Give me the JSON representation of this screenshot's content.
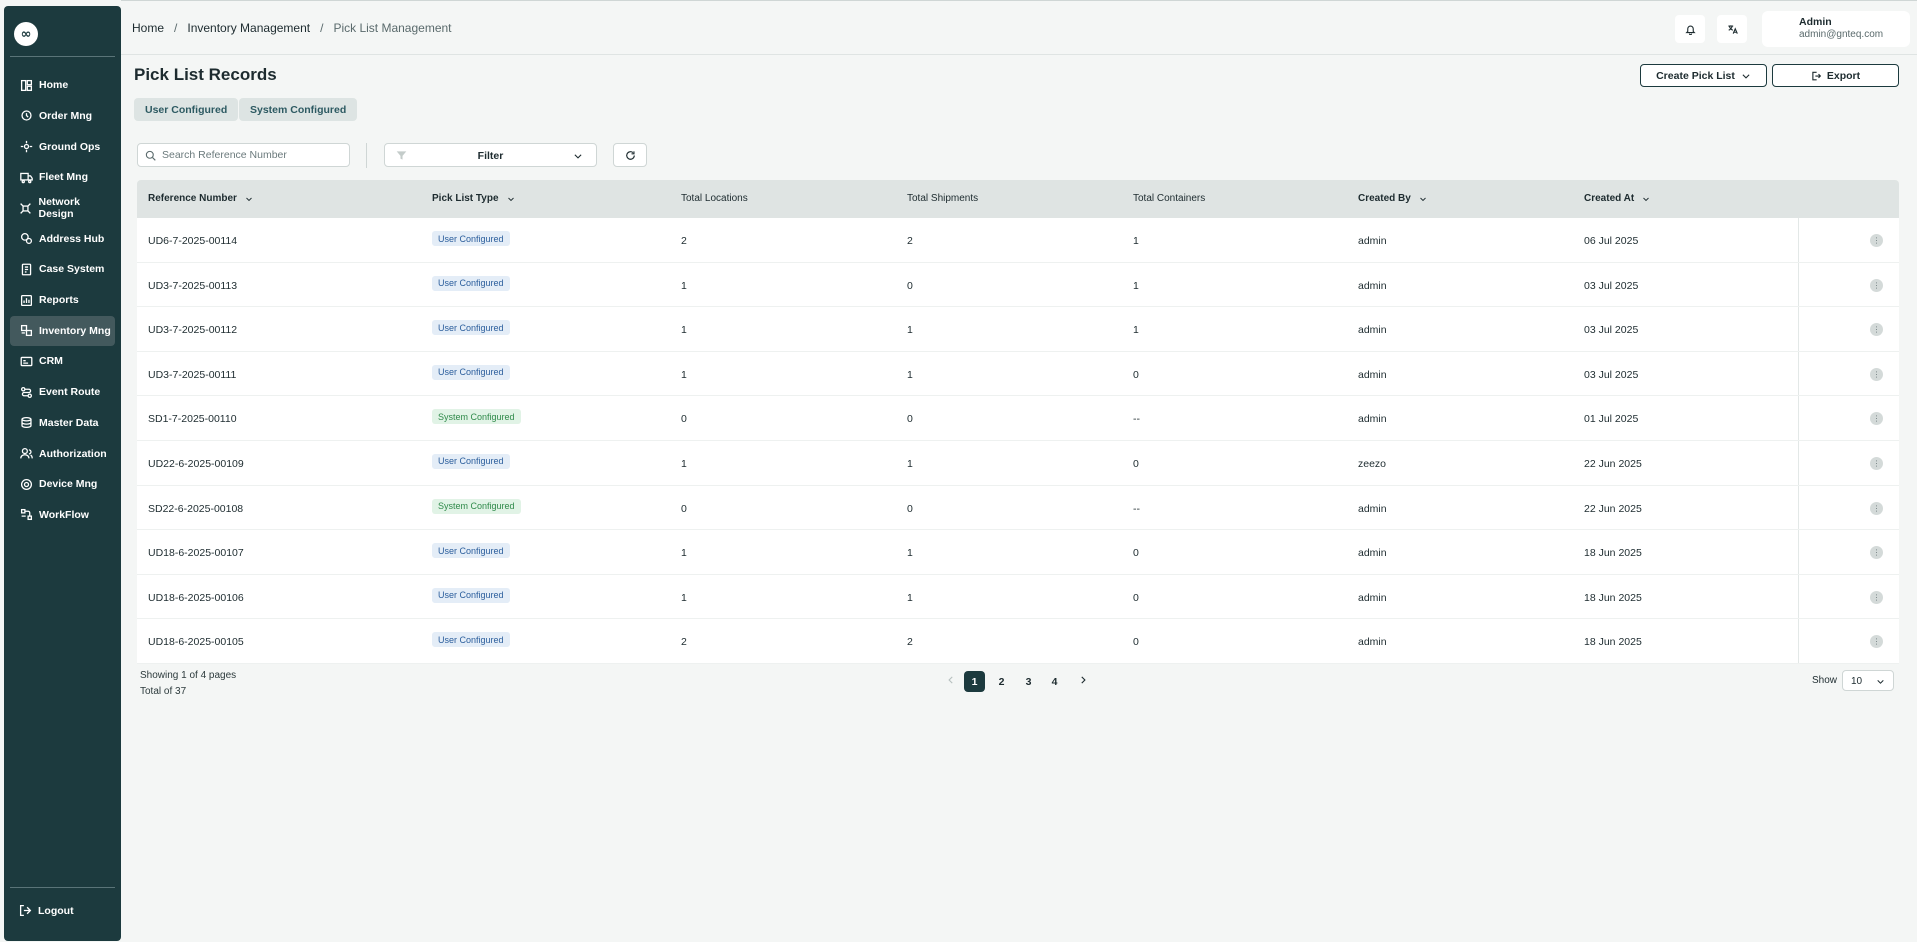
{
  "app": {
    "logo_glyph": "∞",
    "accent_color": "#1c3a3e"
  },
  "sidebar": {
    "items": [
      {
        "label": "Home",
        "icon": "home-icon"
      },
      {
        "label": "Order Mng",
        "icon": "order-icon"
      },
      {
        "label": "Ground Ops",
        "icon": "ground-ops-icon"
      },
      {
        "label": "Fleet Mng",
        "icon": "truck-icon"
      },
      {
        "label": "Network Design",
        "icon": "network-icon"
      },
      {
        "label": "Address Hub",
        "icon": "address-icon"
      },
      {
        "label": "Case System",
        "icon": "case-icon"
      },
      {
        "label": "Reports",
        "icon": "reports-icon"
      },
      {
        "label": "Inventory Mng",
        "icon": "inventory-icon",
        "active": true
      },
      {
        "label": "CRM",
        "icon": "crm-icon"
      },
      {
        "label": "Event Route",
        "icon": "route-icon"
      },
      {
        "label": "Master Data",
        "icon": "database-icon"
      },
      {
        "label": "Authorization",
        "icon": "users-icon"
      },
      {
        "label": "Device Mng",
        "icon": "device-icon"
      },
      {
        "label": "WorkFlow",
        "icon": "workflow-icon"
      }
    ],
    "logout_label": "Logout"
  },
  "header": {
    "breadcrumb": [
      "Home",
      "Inventory Management",
      "Pick List Management"
    ],
    "separator": "/",
    "user_name": "Admin",
    "user_email": "admin@gnteq.com"
  },
  "page": {
    "title": "Pick List Records",
    "create_label": "Create Pick List",
    "export_label": "Export",
    "tabs": [
      "User Configured",
      "System Configured"
    ],
    "search_placeholder": "Search Reference Number",
    "filter_label": "Filter"
  },
  "table": {
    "columns": [
      "Reference Number",
      "Pick List Type",
      "Total Locations",
      "Total Shipments",
      "Total Containers",
      "Created By",
      "Created At"
    ],
    "rows": [
      {
        "ref": "UD6-7-2025-00114",
        "type": "User Configured",
        "locations": "2",
        "shipments": "2",
        "containers": "1",
        "created_by": "admin",
        "created_at": "06 Jul 2025"
      },
      {
        "ref": "UD3-7-2025-00113",
        "type": "User Configured",
        "locations": "1",
        "shipments": "0",
        "containers": "1",
        "created_by": "admin",
        "created_at": "03 Jul 2025"
      },
      {
        "ref": "UD3-7-2025-00112",
        "type": "User Configured",
        "locations": "1",
        "shipments": "1",
        "containers": "1",
        "created_by": "admin",
        "created_at": "03 Jul 2025"
      },
      {
        "ref": "UD3-7-2025-00111",
        "type": "User Configured",
        "locations": "1",
        "shipments": "1",
        "containers": "0",
        "created_by": "admin",
        "created_at": "03 Jul 2025"
      },
      {
        "ref": "SD1-7-2025-00110",
        "type": "System Configured",
        "locations": "0",
        "shipments": "0",
        "containers": "--",
        "created_by": "admin",
        "created_at": "01 Jul 2025"
      },
      {
        "ref": "UD22-6-2025-00109",
        "type": "User Configured",
        "locations": "1",
        "shipments": "1",
        "containers": "0",
        "created_by": "zeezo",
        "created_at": "22 Jun 2025"
      },
      {
        "ref": "SD22-6-2025-00108",
        "type": "System Configured",
        "locations": "0",
        "shipments": "0",
        "containers": "--",
        "created_by": "admin",
        "created_at": "22 Jun 2025"
      },
      {
        "ref": "UD18-6-2025-00107",
        "type": "User Configured",
        "locations": "1",
        "shipments": "1",
        "containers": "0",
        "created_by": "admin",
        "created_at": "18 Jun 2025"
      },
      {
        "ref": "UD18-6-2025-00106",
        "type": "User Configured",
        "locations": "1",
        "shipments": "1",
        "containers": "0",
        "created_by": "admin",
        "created_at": "18 Jun 2025"
      },
      {
        "ref": "UD18-6-2025-00105",
        "type": "User Configured",
        "locations": "2",
        "shipments": "2",
        "containers": "0",
        "created_by": "admin",
        "created_at": "18 Jun 2025"
      }
    ]
  },
  "pagination": {
    "showing": "Showing 1 of 4 pages",
    "total": "Total of 37",
    "pages": [
      "1",
      "2",
      "3",
      "4"
    ],
    "current_page": "1",
    "show_label": "Show",
    "page_size": "10"
  }
}
